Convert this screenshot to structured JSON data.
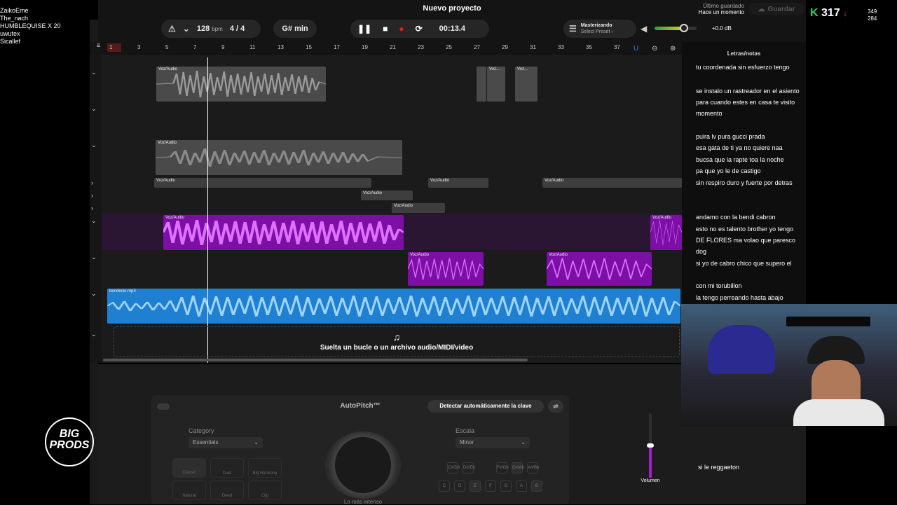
{
  "chat": {
    "lines": [
      "ZaikoEme",
      "The_nach",
      "HUMBLEQUISE X 20",
      "uwutex",
      "Sicallef"
    ]
  },
  "header": {
    "title": "Nuevo proyecto",
    "bpm_value": "128",
    "bpm_unit": "bpm",
    "time_signature": "4 / 4",
    "key": "G# min",
    "time": "00:13.4",
    "mastering_label": "Masterizando",
    "mastering_preset": "Select Preset ›",
    "volume_db": "+0.0 dB",
    "saved_label": "Último guardado",
    "saved_when": "Hace un momento",
    "save_button": "Guardar",
    "volume_fraction": 0.7
  },
  "counter": {
    "value": "317",
    "stat1": "349",
    "stat2": "284"
  },
  "ruler": [
    "1",
    "3",
    "5",
    "7",
    "9",
    "11",
    "13",
    "15",
    "17",
    "19",
    "21",
    "23",
    "25",
    "27",
    "29",
    "31",
    "33",
    "35",
    "37"
  ],
  "clips": {
    "voz": "Voz/Audio",
    "voz_short": "Voz...",
    "bendecio": "bendecio.mp3"
  },
  "dropzone": "Suelta un bucle o un archivo audio/MIDI/video",
  "autopitch": {
    "title": "AutoPitch™",
    "detect": "Detectar automáticamente la clave",
    "category_label": "Category",
    "category_value": "Essentials",
    "scale_label": "Escala",
    "scale_value": "Minor",
    "modes": [
      "Classic",
      "Duet",
      "Big Harmony",
      "Natural",
      "Deed",
      "Clip"
    ],
    "knob_label": "Lo más intenso",
    "sharps": [
      "C#/Db",
      "D#/Eb",
      "F#/Gb",
      "G#/Ab",
      "A#/Bb"
    ],
    "naturals": [
      "C",
      "D",
      "E",
      "F",
      "G",
      "A",
      "B"
    ],
    "volume_label": "Volumen"
  },
  "lyrics": {
    "title": "Letras/notas",
    "lines": [
      "tu coordenada sin esfuerzo tengo",
      "",
      "se instalo un rastreador en el asiento",
      "para cuando estes en casa te visito",
      "momento",
      "",
      "puira lv pura gucci prada",
      "esa gata de ti ya no quiere naa",
      "bucsa que la rapte toa la noche",
      "pa que yo le de castigo",
      "sin respiro duro y fuerte   por detras",
      "",
      "",
      "andamo con la bendi cabron",
      "esto no es talento brother yo tengo",
      " DE FLORES ma volao que paresco",
      "dog",
      "si yo de cabro chico que supero el",
      "",
      "con mi torubillon",
      "la tengo perreando hasta abajo"
    ],
    "extra": "si le reggaeton"
  },
  "logo": {
    "line1": "BIG",
    "line2": "PRODS"
  }
}
